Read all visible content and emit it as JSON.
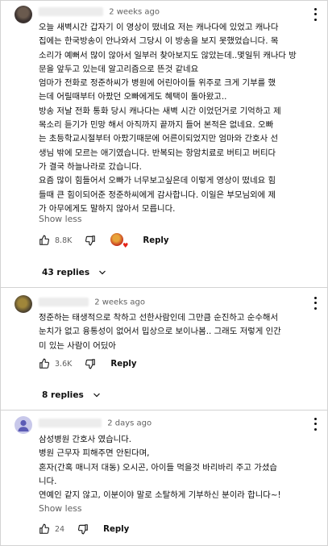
{
  "comments": [
    {
      "time": "2 weeks ago",
      "lines": [
        "오늘 새벽시간 갑자기 이 영상이 떴네요 저는 캐나다에 있었고 캐나다",
        "집에는 한국방송이 안나와서 그당시 이 방송을 보지 못했었습니다. 목",
        "소리가 예뻐서 많이 않아서 일부러 찾아보지도 않았는데..몇일뒤 캐나다 방",
        "문을 앞두고 있는데 알고리즘으로 뜬것 같네요",
        "엄마가 전화로 정준하씨가 병원에 어린아이들 위주로 크게 기부를 했",
        "는데 어릴때부터 아팠던 오빠에게도 혜택이 돌아왔고..",
        "방송 저날 전화 통화 당시 캐나다는 새벽 시간 이었던거로 기억하고 제",
        "목소리 듣기가 민망 해서 아직까지 끝까지 들어 본적은 없네요.  오빠",
        "는 초등학교시절부터 아팠기때문에 어른이되었지만 엄마와 간호사 선",
        "생님 밖에 모르는 애기였습니다.  반복되는 항암치료로 버티고 버티다",
        "가 결국 하늘나라로 갔습니다.",
        "요즘 많이 힘들어서 오빠가 너무보고싶은데 이렇게 영상이 떴네요 힘",
        "들때 큰 힘이되어준 정준하씨에게 감사합니다. 이일은 부모님외에 제",
        "가 아무에게도 말하지 않아서 모릅니다."
      ],
      "show_less": "Show less",
      "likes": "8.8K",
      "reply_label": "Reply",
      "replies_label": "43 replies"
    },
    {
      "time": "2 weeks ago",
      "lines": [
        "정준하는 태생적으로 착하고 선한사람인데 그만큼 순진하고 순수해서",
        "눈치가 없고 융통성이 없어서 밉상으로 보이나봄.. 그래도 저렇게 인간",
        "미 있는 사람이 어딨아"
      ],
      "likes": "3.6K",
      "reply_label": "Reply",
      "replies_label": "8 replies"
    },
    {
      "time": "2 days ago",
      "lines": [
        "삼성병원 간호사 였습니다.",
        "병원 근무자 피해주면 안된다며,",
        "혼자(간혹 매니저 대동) 오시곤, 아이들 먹을것 바리바리 주고 가셨습",
        "니다.",
        "연예인 같지 않고, 이분이야 말로 소탈하게 기부하신 분이라 합니다~!"
      ],
      "show_less": "Show less",
      "likes": "24",
      "reply_label": "Reply"
    }
  ],
  "icons": {
    "like": "thumbs-up-icon",
    "dislike": "thumbs-down-icon",
    "expand": "chevron-down-icon",
    "menu": "more-vert-icon",
    "creator_heart": "creator-heart-icon"
  },
  "colors": {
    "text": "#0f0f0f",
    "meta": "#606060",
    "divider": "#d3d3d3",
    "heart": "#e62117"
  }
}
